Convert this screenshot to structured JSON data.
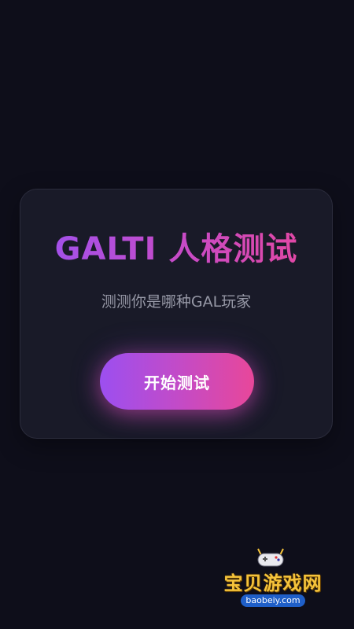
{
  "app": {
    "title": "GALTI 人格测试",
    "subtitle": "测测你是哪种GAL玩家",
    "start_button_label": "开始测试"
  },
  "colors": {
    "background": "#0e0e1a",
    "card": "#191a28",
    "accent_start": "#9c4ff0",
    "accent_end": "#e8479a"
  },
  "watermark": {
    "name": "宝贝游戏网",
    "url": "baobeiy.com",
    "icon": "gamepad-mascot-icon"
  }
}
